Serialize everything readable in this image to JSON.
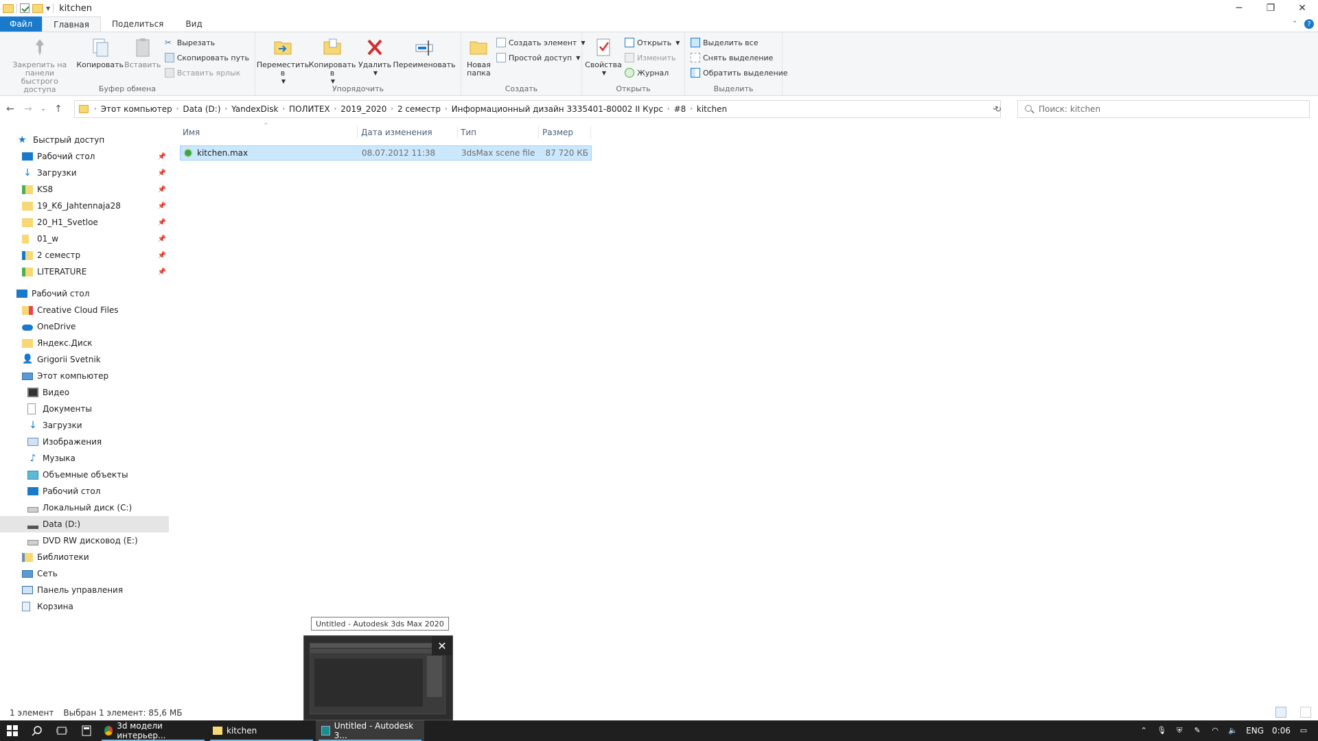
{
  "window": {
    "title": "kitchen",
    "minimize": "─",
    "restore": "❐",
    "close": "✕"
  },
  "ribbon_tabs": [
    {
      "label": "Файл"
    },
    {
      "label": "Главная"
    },
    {
      "label": "Поделиться"
    },
    {
      "label": "Вид"
    }
  ],
  "ribbon": {
    "clipboard": {
      "pin_label": "Закрепить на панели быстрого доступа",
      "copy_label": "Копировать",
      "paste_label": "Вставить",
      "cut_label": "Вырезать",
      "copy_path_label": "Скопировать путь",
      "paste_shortcut_label": "Вставить ярлык",
      "group_label": "Буфер обмена"
    },
    "organize": {
      "move_label": "Переместить в",
      "copy_to_label": "Копировать в",
      "delete_label": "Удалить",
      "rename_label": "Переименовать",
      "group_label": "Упорядочить"
    },
    "create": {
      "new_folder_label": "Новая папка",
      "new_item_label": "Создать элемент",
      "easy_access_label": "Простой доступ",
      "group_label": "Создать"
    },
    "open": {
      "properties_label": "Свойства",
      "open_label": "Открыть",
      "edit_label": "Изменить",
      "history_label": "Журнал",
      "group_label": "Открыть"
    },
    "select": {
      "select_all_label": "Выделить все",
      "select_none_label": "Снять выделение",
      "invert_label": "Обратить выделение",
      "group_label": "Выделить"
    }
  },
  "address": {
    "crumbs": [
      "Этот компьютер",
      "Data (D:)",
      "YandexDisk",
      "ПОЛИТЕХ",
      "2019_2020",
      "2 семестр",
      "Информационный дизайн 3335401-80002 II Курс",
      "#8",
      "kitchen"
    ],
    "search_placeholder": "Поиск: kitchen"
  },
  "nav_pane": {
    "quick_access": "Быстрый доступ",
    "quick_items": [
      {
        "label": "Рабочий стол"
      },
      {
        "label": "Загрузки"
      },
      {
        "label": "KS8"
      },
      {
        "label": "19_K6_Jahtennaja28"
      },
      {
        "label": "20_H1_Svetloe"
      },
      {
        "label": "01_w"
      },
      {
        "label": "2 семестр"
      },
      {
        "label": "LITERATURE"
      }
    ],
    "desktop": "Рабочий стол",
    "desktop_items": [
      {
        "label": "Creative Cloud Files"
      },
      {
        "label": "OneDrive"
      },
      {
        "label": "Яндекс.Диск"
      },
      {
        "label": "Grigorii Svetnik"
      },
      {
        "label": "Этот компьютер"
      }
    ],
    "pc_items": [
      {
        "label": "Видео"
      },
      {
        "label": "Документы"
      },
      {
        "label": "Загрузки"
      },
      {
        "label": "Изображения"
      },
      {
        "label": "Музыка"
      },
      {
        "label": "Объемные объекты"
      },
      {
        "label": "Рабочий стол"
      },
      {
        "label": "Локальный диск (C:)"
      },
      {
        "label": "Data (D:)"
      },
      {
        "label": "DVD RW дисковод (E:)"
      }
    ],
    "bottom_items": [
      {
        "label": "Библиотеки"
      },
      {
        "label": "Сеть"
      },
      {
        "label": "Панель управления"
      },
      {
        "label": "Корзина"
      }
    ]
  },
  "file_list": {
    "columns": [
      "Имя",
      "Дата изменения",
      "Тип",
      "Размер"
    ],
    "rows": [
      {
        "name": "kitchen.max",
        "modified": "08.07.2012 11:38",
        "type": "3dsMax scene file",
        "size": "87 720 КБ"
      }
    ]
  },
  "status": {
    "count": "1 элемент",
    "selected": "Выбран 1 элемент: 85,6 МБ"
  },
  "taskbar": {
    "apps": [
      {
        "label": "3d модели интерьер..."
      },
      {
        "label": "kitchen"
      },
      {
        "label": "Untitled - Autodesk 3..."
      }
    ],
    "lang": "ENG",
    "time": "0:06"
  },
  "preview": {
    "tooltip": "Untitled - Autodesk 3ds Max 2020"
  },
  "colors": {
    "accent": "#1979ca",
    "selection": "#cce8ff",
    "taskbar": "#1f1f1f"
  }
}
